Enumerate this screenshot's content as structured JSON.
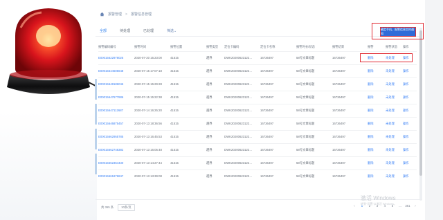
{
  "breadcrumb": {
    "first": "报警管理",
    "second": "报警信息管理"
  },
  "tabs": [
    {
      "label": "全部"
    },
    {
      "label": "待处理"
    },
    {
      "label": "已处理"
    }
  ],
  "filter": {
    "label": "筛选⌄"
  },
  "alert_button": {
    "label": "确定手机、报警信息实时通知"
  },
  "table": {
    "headers": [
      "报警编码编号",
      "报警时间",
      "报警位置",
      "报警类型",
      "定位卡编码",
      "定位卡名称",
      "报警时长/状态",
      "报警结束",
      "报警",
      "报警状态",
      "操作"
    ],
    "rows": [
      [
        "E00015622978025",
        "2020-07-20 15:23:00",
        "41515",
        "越界",
        "DWK20200623122…",
        "16736497",
        "58号文章标题",
        "16736497",
        "删除",
        "未处理",
        "操作"
      ],
      [
        "E00015644605648",
        "2020-07-15 17:07:18",
        "41515",
        "越界",
        "DWK20200623122…",
        "16736497",
        "58号文章标题",
        "16736497",
        "删除",
        "未处理",
        "操作"
      ],
      [
        "E00015648186046",
        "2020-07-15 15:29:28",
        "41515",
        "越界",
        "DWK20200623122…",
        "16736497",
        "58号文章标题",
        "16736497",
        "删除",
        "未处理",
        "操作"
      ],
      [
        "E00015647677886",
        "2020-07-15 15:22:38",
        "41515",
        "越界",
        "DWK20200623122…",
        "16736497",
        "58号文章标题",
        "16736497",
        "删除",
        "未处理",
        "操作"
      ],
      [
        "E00015647112687",
        "2020-07-14 16:25:20",
        "41515",
        "越界",
        "DWK20200623122…",
        "16736497",
        "58号文章标题",
        "16736497",
        "删除",
        "未处理",
        "操作"
      ],
      [
        "E00015646875457",
        "2020-07-13 18:36:56",
        "41515",
        "越界",
        "DWK20200623122…",
        "16736497",
        "58号文章标题",
        "16736497",
        "删除",
        "未处理",
        "操作"
      ],
      [
        "E00015662955785",
        "2020-07-13 16:45:53",
        "41515",
        "越界",
        "DWK20200623122…",
        "16736497",
        "58号文章标题",
        "16736497",
        "删除",
        "未处理",
        "操作"
      ],
      [
        "E00015662748382",
        "2020-07-13 16:05:48",
        "41515",
        "越界",
        "DWK20200623122…",
        "16736497",
        "58号文章标题",
        "16736497",
        "删除",
        "未处理",
        "操作"
      ],
      [
        "E00015662364430",
        "2020-07-13 14:27:44",
        "41515",
        "越界",
        "DWK20200623122…",
        "16736497",
        "58号文章标题",
        "16736497",
        "删除",
        "未处理",
        "操作"
      ],
      [
        "E00015661876847",
        "2020-07-13 13:39:08",
        "41515",
        "越界",
        "DWK20200623122…",
        "16736497",
        "58号文章标题",
        "16736497",
        "删除",
        "未处理",
        "操作"
      ]
    ]
  },
  "footer": {
    "total": "共 365 条",
    "page_size": "10条/页",
    "pages": [
      "‹",
      "1",
      "2",
      "3",
      "4",
      "5",
      "…",
      "361",
      "›"
    ]
  },
  "watermark": {
    "line1": "激活 Windows",
    "line2": "转到“设置”以激活 Windows。"
  },
  "colors": {
    "accent": "#2f80ed",
    "alert": "#e0262f",
    "siren_red": "#d8141c"
  }
}
